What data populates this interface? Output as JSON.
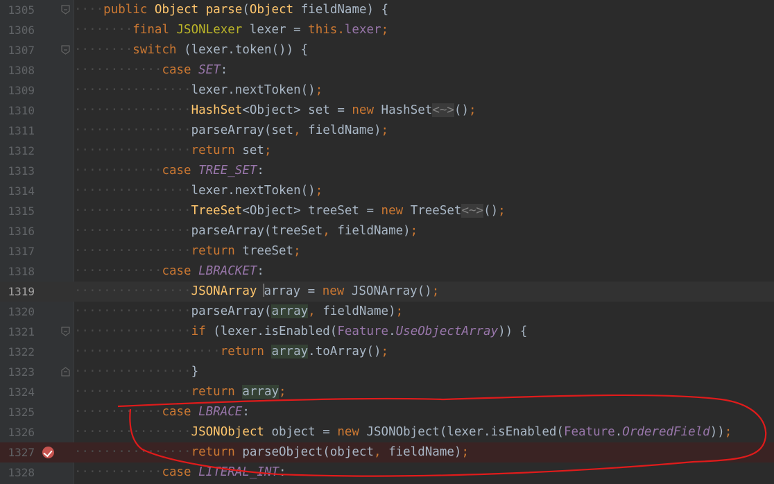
{
  "editor": {
    "lines": [
      {
        "num": "1305",
        "indent": "····",
        "segs": [
          [
            "public ",
            "kw"
          ],
          [
            "Object ",
            "ty"
          ],
          [
            "parse",
            "ty"
          ],
          [
            "(",
            ""
          ],
          [
            "Object ",
            "ty"
          ],
          [
            "fieldName) {",
            ""
          ]
        ]
      },
      {
        "num": "1306",
        "indent": "········",
        "segs": [
          [
            "final ",
            "kw"
          ],
          [
            "JSONLexer ",
            "ma"
          ],
          [
            "lexer = ",
            ""
          ],
          [
            "this",
            ""
          ],
          [
            ".",
            "kw"
          ],
          [
            "lexer",
            ""
          ],
          [
            ";",
            "kw"
          ]
        ]
      },
      {
        "num": "1307",
        "indent": "········",
        "segs": [
          [
            "switch ",
            "kw"
          ],
          [
            "(lexer.token()) {",
            ""
          ]
        ]
      },
      {
        "num": "1308",
        "indent": "············",
        "segs": [
          [
            "case ",
            "kw"
          ],
          [
            "SET",
            ""
          ],
          [
            ":",
            ""
          ]
        ]
      },
      {
        "num": "1309",
        "indent": "················",
        "segs": [
          [
            "lexer.nextToken()",
            ""
          ],
          [
            ";",
            "kw"
          ]
        ]
      },
      {
        "num": "1310",
        "indent": "················",
        "segs": [
          [
            "HashSet",
            "ty"
          ],
          [
            "<Object> ",
            ""
          ],
          [
            "set = ",
            ""
          ],
          [
            "new ",
            "kw"
          ],
          [
            "HashSet",
            ""
          ],
          [
            "<~>",
            ""
          ],
          [
            "()",
            ""
          ],
          [
            ";",
            "kw"
          ]
        ]
      },
      {
        "num": "1311",
        "indent": "················",
        "segs": [
          [
            "parseArray(set",
            ""
          ],
          [
            ", ",
            "kw"
          ],
          [
            "fieldName)",
            ""
          ],
          [
            ";",
            "kw"
          ]
        ]
      },
      {
        "num": "1312",
        "indent": "················",
        "segs": [
          [
            "return ",
            "kw"
          ],
          [
            "set",
            ""
          ],
          [
            ";",
            "kw"
          ]
        ]
      },
      {
        "num": "1313",
        "indent": "············",
        "segs": [
          [
            "case ",
            "kw"
          ],
          [
            "TREE_SET",
            ""
          ],
          [
            ":",
            ""
          ]
        ]
      },
      {
        "num": "1314",
        "indent": "················",
        "segs": [
          [
            "lexer.nextToken()",
            ""
          ],
          [
            ";",
            "kw"
          ]
        ]
      },
      {
        "num": "1315",
        "indent": "················",
        "segs": [
          [
            "TreeSet",
            "ty"
          ],
          [
            "<Object> ",
            ""
          ],
          [
            "treeSet = ",
            ""
          ],
          [
            "new ",
            "kw"
          ],
          [
            "TreeSet",
            ""
          ],
          [
            "<~>",
            ""
          ],
          [
            "()",
            ""
          ],
          [
            ";",
            "kw"
          ]
        ]
      },
      {
        "num": "1316",
        "indent": "················",
        "segs": [
          [
            "parseArray(treeSet",
            ""
          ],
          [
            ", ",
            "kw"
          ],
          [
            "fieldName)",
            ""
          ],
          [
            ";",
            "kw"
          ]
        ]
      },
      {
        "num": "1317",
        "indent": "················",
        "segs": [
          [
            "return ",
            "kw"
          ],
          [
            "treeSet",
            ""
          ],
          [
            ";",
            "kw"
          ]
        ]
      },
      {
        "num": "1318",
        "indent": "············",
        "segs": [
          [
            "case ",
            "kw"
          ],
          [
            "LBRACKET",
            ""
          ],
          [
            ":",
            ""
          ]
        ]
      },
      {
        "num": "1319",
        "indent": "················",
        "segs": [
          [
            "JSONArray ",
            "ty"
          ],
          [
            "array",
            ""
          ],
          [
            " = ",
            ""
          ],
          [
            "new ",
            "kw"
          ],
          [
            "JSONArray()",
            ""
          ],
          [
            ";",
            "kw"
          ]
        ]
      },
      {
        "num": "1320",
        "indent": "················",
        "segs": [
          [
            "parseArray(",
            ""
          ],
          [
            "array",
            ""
          ],
          [
            ", ",
            "kw"
          ],
          [
            "fieldName)",
            ""
          ],
          [
            ";",
            "kw"
          ]
        ]
      },
      {
        "num": "1321",
        "indent": "················",
        "segs": [
          [
            "if ",
            "kw"
          ],
          [
            "(lexer.isEnabled(",
            ""
          ],
          [
            "Feature",
            ""
          ],
          [
            ".",
            ""
          ],
          [
            "UseObjectArray",
            ""
          ],
          [
            ")) {",
            ""
          ]
        ]
      },
      {
        "num": "1322",
        "indent": "····················",
        "segs": [
          [
            "return ",
            "kw"
          ],
          [
            "array",
            ""
          ],
          [
            ".toArray()",
            ""
          ],
          [
            ";",
            "kw"
          ]
        ]
      },
      {
        "num": "1323",
        "indent": "················",
        "segs": [
          [
            "}",
            ""
          ]
        ]
      },
      {
        "num": "1324",
        "indent": "················",
        "segs": [
          [
            "return ",
            "kw"
          ],
          [
            "array",
            ""
          ],
          [
            ";",
            "kw"
          ]
        ]
      },
      {
        "num": "1325",
        "indent": "············",
        "segs": [
          [
            "case ",
            "kw"
          ],
          [
            "LBRACE",
            ""
          ],
          [
            ":",
            ""
          ]
        ]
      },
      {
        "num": "1326",
        "indent": "················",
        "segs": [
          [
            "JSONObject ",
            "ty"
          ],
          [
            "object = ",
            ""
          ],
          [
            "new ",
            "kw"
          ],
          [
            "JSONObject(lexer.isEnabled(",
            ""
          ],
          [
            "Feature",
            ""
          ],
          [
            ".",
            ""
          ],
          [
            "OrderedField",
            ""
          ],
          [
            "))",
            ""
          ],
          [
            ";",
            "kw"
          ]
        ]
      },
      {
        "num": "1327",
        "indent": "················",
        "segs": [
          [
            "return ",
            "kw"
          ],
          [
            "parseObject(object",
            ""
          ],
          [
            ", ",
            "kw"
          ],
          [
            "fieldName)",
            ""
          ],
          [
            ";",
            "kw"
          ]
        ]
      },
      {
        "num": "1328",
        "indent": "············",
        "segs": [
          [
            "case ",
            "kw"
          ],
          [
            "LITERAL_INT",
            ""
          ],
          [
            ":",
            ""
          ]
        ]
      }
    ]
  },
  "colors": {
    "background": "#2b2b2b",
    "keyword": "#cc7832",
    "type": "#ffc66d",
    "field": "#9876aa",
    "text": "#a9b7c6",
    "annotation_red": "#e01b1b"
  },
  "icons": [
    "fold-marker-icon",
    "breakpoint-check-icon"
  ]
}
